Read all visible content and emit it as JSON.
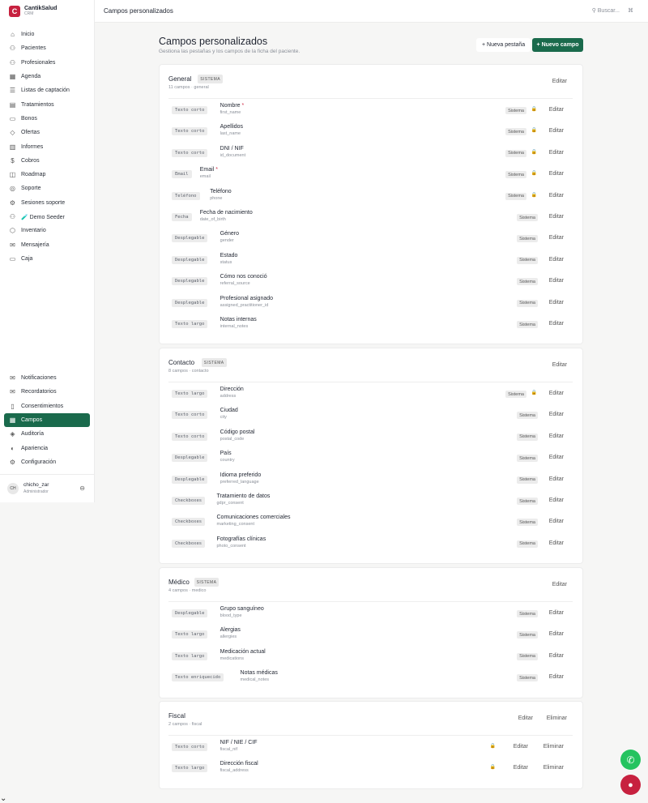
{
  "brand": {
    "name": "CantikSalud",
    "sub": "CRM",
    "logo": "C"
  },
  "nav_main": [
    {
      "label": "Inicio",
      "icon": "home-icon",
      "glyph": "⌂"
    },
    {
      "label": "Pacientes",
      "icon": "users-icon",
      "glyph": "⚇"
    },
    {
      "label": "Profesionales",
      "icon": "professionals-icon",
      "glyph": "⚇"
    },
    {
      "label": "Agenda",
      "icon": "calendar-icon",
      "glyph": "▦"
    },
    {
      "label": "Listas de captación",
      "icon": "list-icon",
      "glyph": "☰"
    },
    {
      "label": "Tratamientos",
      "icon": "treatments-icon",
      "glyph": "▤"
    },
    {
      "label": "Bonos",
      "icon": "voucher-icon",
      "glyph": "▭"
    },
    {
      "label": "Ofertas",
      "icon": "tag-icon",
      "glyph": "◇"
    },
    {
      "label": "Informes",
      "icon": "chart-icon",
      "glyph": "▥"
    },
    {
      "label": "Cobros",
      "icon": "payments-icon",
      "glyph": "$"
    },
    {
      "label": "Roadmap",
      "icon": "roadmap-icon",
      "glyph": "◫"
    },
    {
      "label": "Soporte",
      "icon": "globe-icon",
      "glyph": "◎"
    },
    {
      "label": "Sesiones soporte",
      "icon": "sessions-icon",
      "glyph": "⚙"
    },
    {
      "label": "🧪 Demo Seeder",
      "icon": "seeder-icon",
      "glyph": "⚇"
    },
    {
      "label": "Inventario",
      "icon": "box-icon",
      "glyph": "⬡"
    },
    {
      "label": "Mensajería",
      "icon": "message-icon",
      "glyph": "✉"
    },
    {
      "label": "Caja",
      "icon": "cash-icon",
      "glyph": "▭"
    }
  ],
  "nav_bottom": [
    {
      "label": "Notificaciones",
      "icon": "mail-icon",
      "glyph": "✉"
    },
    {
      "label": "Recordatorios",
      "icon": "reminder-icon",
      "glyph": "✉"
    },
    {
      "label": "Consentimientos",
      "icon": "document-icon",
      "glyph": "▯"
    },
    {
      "label": "Campos",
      "icon": "fields-icon",
      "glyph": "▦",
      "active": true
    },
    {
      "label": "Auditoría",
      "icon": "audit-icon",
      "glyph": "◈"
    },
    {
      "label": "Apariencia",
      "icon": "appearance-icon",
      "glyph": "◐"
    },
    {
      "label": "Configuración",
      "icon": "settings-icon",
      "glyph": "⚙"
    }
  ],
  "user": {
    "initials": "CH",
    "name": "chicho_zar",
    "role": "Administrador"
  },
  "topbar": {
    "title": "Campos personalizados",
    "search": "Buscar...",
    "shortcut": "⌘"
  },
  "header": {
    "title": "Campos personalizados",
    "subtitle": "Gestiona las pestañas y los campos de la ficha del paciente.",
    "new_tab": "+ Nueva pestaña",
    "new_field": "+ Nuevo campo"
  },
  "labels": {
    "edit": "Editar",
    "delete": "Eliminar",
    "system": "Sistema",
    "system_badge": "SISTEMA"
  },
  "sections": [
    {
      "title": "General",
      "system": true,
      "meta": "11 campos · general",
      "fields": [
        {
          "type": "Texto corto",
          "name": "Nombre",
          "required": true,
          "key": "first_name",
          "locked": true
        },
        {
          "type": "Texto corto",
          "name": "Apellidos",
          "required": false,
          "key": "last_name",
          "locked": true
        },
        {
          "type": "Texto corto",
          "name": "DNI / NIF",
          "required": false,
          "key": "id_document",
          "locked": true
        },
        {
          "type": "Email",
          "name": "Email",
          "required": true,
          "key": "email",
          "locked": true
        },
        {
          "type": "Teléfono",
          "name": "Teléfono",
          "required": false,
          "key": "phone",
          "locked": true
        },
        {
          "type": "Fecha",
          "name": "Fecha de nacimiento",
          "required": false,
          "key": "date_of_birth",
          "locked": false
        },
        {
          "type": "Desplegable",
          "name": "Género",
          "required": false,
          "key": "gender",
          "locked": false
        },
        {
          "type": "Desplegable",
          "name": "Estado",
          "required": false,
          "key": "status",
          "locked": false
        },
        {
          "type": "Desplegable",
          "name": "Cómo nos conoció",
          "required": false,
          "key": "referral_source",
          "locked": false
        },
        {
          "type": "Desplegable",
          "name": "Profesional asignado",
          "required": false,
          "key": "assigned_practitioner_id",
          "locked": false
        },
        {
          "type": "Texto largo",
          "name": "Notas internas",
          "required": false,
          "key": "internal_notes",
          "locked": false
        }
      ]
    },
    {
      "title": "Contacto",
      "system": true,
      "meta": "8 campos · contacto",
      "fields": [
        {
          "type": "Texto largo",
          "name": "Dirección",
          "required": false,
          "key": "address",
          "locked": true
        },
        {
          "type": "Texto corto",
          "name": "Ciudad",
          "required": false,
          "key": "city",
          "locked": false
        },
        {
          "type": "Texto corto",
          "name": "Código postal",
          "required": false,
          "key": "postal_code",
          "locked": false
        },
        {
          "type": "Desplegable",
          "name": "País",
          "required": false,
          "key": "country",
          "locked": false
        },
        {
          "type": "Desplegable",
          "name": "Idioma preferido",
          "required": false,
          "key": "preferred_language",
          "locked": false
        },
        {
          "type": "Checkboxes",
          "name": "Tratamiento de datos",
          "required": false,
          "key": "gdpr_consent",
          "locked": false
        },
        {
          "type": "Checkboxes",
          "name": "Comunicaciones comerciales",
          "required": false,
          "key": "marketing_consent",
          "locked": false
        },
        {
          "type": "Checkboxes",
          "name": "Fotografías clínicas",
          "required": false,
          "key": "photo_consent",
          "locked": false
        }
      ]
    },
    {
      "title": "Médico",
      "system": true,
      "meta": "4 campos · medico",
      "fields": [
        {
          "type": "Desplegable",
          "name": "Grupo sanguíneo",
          "required": false,
          "key": "blood_type",
          "locked": false
        },
        {
          "type": "Texto largo",
          "name": "Alergias",
          "required": false,
          "key": "allergies",
          "locked": false
        },
        {
          "type": "Texto largo",
          "name": "Medicación actual",
          "required": false,
          "key": "medications",
          "locked": false
        },
        {
          "type": "Texto enriquecido",
          "name": "Notas médicas",
          "required": false,
          "key": "medical_notes",
          "locked": false
        }
      ]
    },
    {
      "title": "Fiscal",
      "system": false,
      "meta": "2 campos · fiscal",
      "fields": [
        {
          "type": "Texto corto",
          "name": "NIF / NIE / CIF",
          "required": false,
          "key": "fiscal_nif",
          "locked": true,
          "custom": true
        },
        {
          "type": "Texto largo",
          "name": "Dirección fiscal",
          "required": false,
          "key": "fiscal_address",
          "locked": true,
          "custom": true
        }
      ]
    }
  ]
}
